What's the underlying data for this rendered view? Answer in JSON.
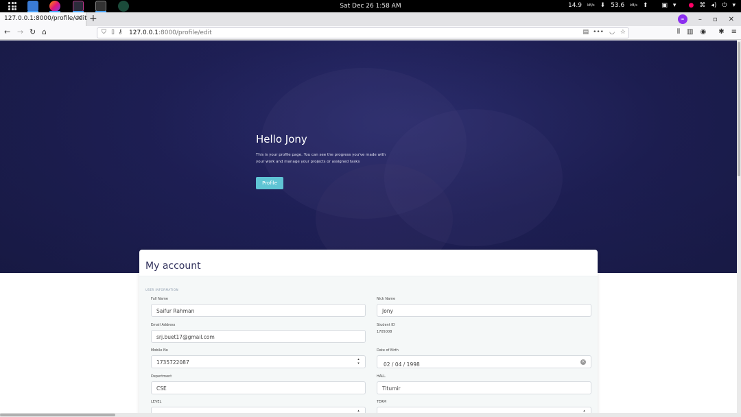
{
  "system_bar": {
    "clock": "Sat Dec 26  1:58 AM",
    "net_down": "14.9",
    "net_down_unit": "kB/s",
    "net_up": "53.6",
    "net_up_unit": "kB/s"
  },
  "browser": {
    "tab_title": "127.0.0.1:8000/profile/edit",
    "url_host": "127.0.0.1",
    "url_path": ":8000/profile/edit",
    "new_tab": "+"
  },
  "hero": {
    "greeting": "Hello Jony",
    "description": "This is your profile page. You can see the progress you've made with your work and manage your projects or assigned tasks",
    "profile_button": "Profile"
  },
  "account": {
    "title": "My account",
    "section": "USER INFORMATION",
    "full_name_label": "Full Name",
    "full_name": "Saifur Rahman",
    "nick_name_label": "Nick Name",
    "nick_name": "Jony",
    "email_label": "Email Address",
    "email": "srj.buet17@gmail.com",
    "student_id_label": "Student ID",
    "student_id": "1705008",
    "mobile_label": "Mobile No",
    "mobile": "1735722087",
    "dob_label": "Date of Birth",
    "dob": "02 / 04 / 1998",
    "department_label": "Depertment",
    "department": "CSE",
    "hall_label": "HALL",
    "hall": "Titumir",
    "level_label": "LEVEL",
    "term_label": "TERM"
  }
}
